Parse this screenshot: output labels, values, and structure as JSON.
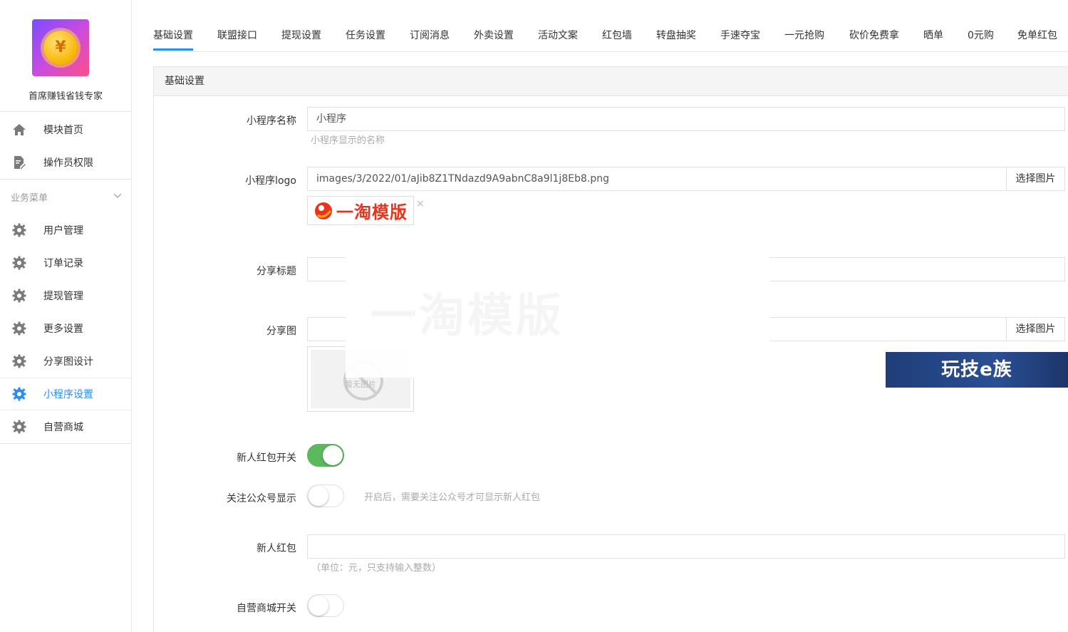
{
  "brand": {
    "name": "首席赚钱省钱专家",
    "coin_symbol": "¥"
  },
  "sidebar": {
    "top_items": [
      {
        "label": "模块首页",
        "icon": "home-icon"
      },
      {
        "label": "操作员权限",
        "icon": "document-edit-icon"
      }
    ],
    "section_title": "业务菜单",
    "items": [
      {
        "label": "用户管理",
        "icon": "gear-icon"
      },
      {
        "label": "订单记录",
        "icon": "gear-icon"
      },
      {
        "label": "提现管理",
        "icon": "gear-icon"
      },
      {
        "label": "更多设置",
        "icon": "gear-icon"
      },
      {
        "label": "分享图设计",
        "icon": "gear-icon"
      },
      {
        "label": "小程序设置",
        "icon": "gear-icon",
        "active": true
      },
      {
        "label": "自营商城",
        "icon": "gear-icon"
      }
    ]
  },
  "tabs": [
    "基础设置",
    "联盟接口",
    "提现设置",
    "任务设置",
    "订阅消息",
    "外卖设置",
    "活动文案",
    "红包墙",
    "转盘抽奖",
    "手速夺宝",
    "一元抢购",
    "砍价免费拿",
    "晒单",
    "0元购",
    "免单红包"
  ],
  "active_tab": "基础设置",
  "panel": {
    "title": "基础设置",
    "fields": {
      "app_name": {
        "label": "小程序名称",
        "value": "小程序",
        "help": "小程序显示的名称"
      },
      "app_logo": {
        "label": "小程序logo",
        "value": "images/3/2022/01/aJib8Z1TNdazd9A9abnC8a9l1j8Eb8.png",
        "button": "选择图片",
        "preview_text": "一淘模版",
        "close": "×"
      },
      "share_title": {
        "label": "分享标题",
        "value": ""
      },
      "share_image": {
        "label": "分享图",
        "value": "",
        "button": "选择图片",
        "placeholder_text": "暂无图片"
      },
      "newbie_switch": {
        "label": "新人红包开关",
        "on": true
      },
      "follow_switch": {
        "label": "关注公众号显示",
        "on": false,
        "help": "开启后，需要关注公众号才可显示新人红包"
      },
      "newbie_amount": {
        "label": "新人红包",
        "value": "",
        "help": "（单位：元，只支持输入整数）"
      },
      "mall_switch": {
        "label": "自营商城开关",
        "on": false
      }
    }
  },
  "overlay": {
    "watermark_text": "一淘模版",
    "ad_text": "玩技e族"
  },
  "colors": {
    "accent": "#2d8cf0",
    "switch_on": "#5cb85c",
    "logo_red": "#e8341c"
  }
}
